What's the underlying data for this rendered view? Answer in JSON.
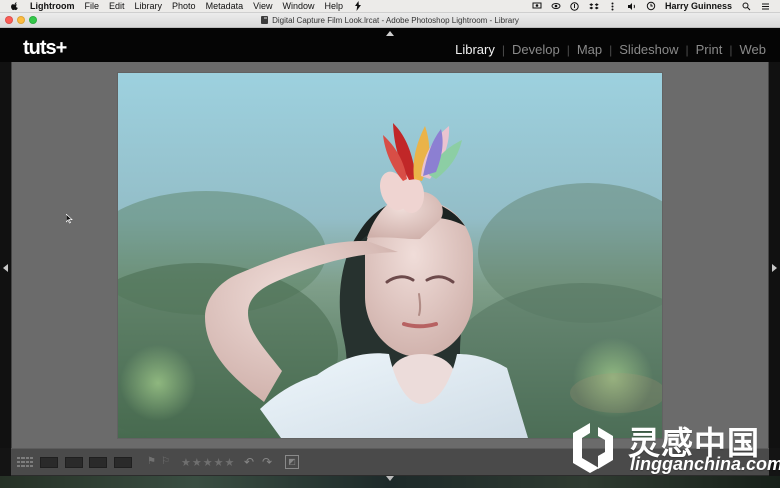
{
  "menubar": {
    "items": [
      "Lightroom",
      "File",
      "Edit",
      "Library",
      "Photo",
      "Metadata",
      "View",
      "Window",
      "Help"
    ],
    "user_name": "Harry Guinness"
  },
  "window": {
    "title": "Digital Capture Film Look.lrcat - Adobe Photoshop Lightroom - Library"
  },
  "branding": {
    "logo": "tuts+"
  },
  "modules": {
    "items": [
      "Library",
      "Develop",
      "Map",
      "Slideshow",
      "Print",
      "Web"
    ],
    "active": "Library"
  },
  "toolbar": {
    "stars": "★★★★★"
  },
  "watermark": {
    "title": "灵感中国",
    "url": "lingganchina.com"
  },
  "colors": {
    "menubar_bg": "#ecebe9",
    "titlebar_bg": "#dfdfdf",
    "lr_header_bg": "#050505",
    "workspace_bg": "#6b6b6b",
    "toolbar_bg": "#4a4a4a",
    "active_module": "#f1f1f1",
    "inactive_module": "#8a8a8a"
  },
  "icons": {
    "apple": "apple-icon",
    "bolt": "bolt-icon",
    "grid": "grid-view-icon",
    "loupe": "loupe-view-icon",
    "compare": "compare-view-icon",
    "survey": "survey-view-icon",
    "people": "people-view-icon",
    "flag": "flag-icon",
    "reject": "reject-flag-icon",
    "rotate_left": "rotate-left-icon",
    "rotate_right": "rotate-right-icon",
    "crop": "crop-overlay-icon"
  }
}
